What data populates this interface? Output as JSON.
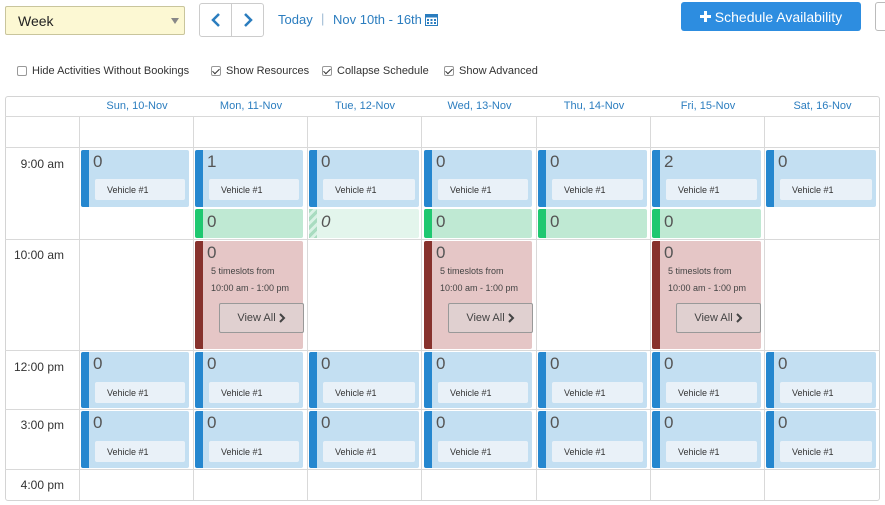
{
  "toolbar": {
    "view_select": "Week",
    "today": "Today",
    "range": "Nov 10th - 16th",
    "schedule_btn": "Schedule Availability"
  },
  "options": [
    {
      "label": "Hide Activities Without Bookings",
      "checked": false
    },
    {
      "label": "Show Resources",
      "checked": true
    },
    {
      "label": "Collapse Schedule",
      "checked": true
    },
    {
      "label": "Show Advanced",
      "checked": true
    }
  ],
  "days": [
    "Sun, 10-Nov",
    "Mon, 11-Nov",
    "Tue, 12-Nov",
    "Wed, 13-Nov",
    "Thu, 14-Nov",
    "Fri, 15-Nov",
    "Sat, 16-Nov"
  ],
  "times": [
    "9:00 am",
    "10:00 am",
    "12:00 pm",
    "3:00 pm",
    "4:00 pm"
  ],
  "resource_label": "Vehicle #1",
  "timeslot_line1": "5 timeslots from",
  "timeslot_line2": "10:00 am - 1:00 pm",
  "view_all": "View All",
  "row_9am_counts": [
    "0",
    "1",
    "0",
    "0",
    "0",
    "2",
    "0"
  ],
  "row_green_counts": [
    "0",
    "0",
    "0",
    "0",
    "0"
  ],
  "row_10am_counts": [
    "0",
    "0",
    "0"
  ],
  "row_12pm_counts": [
    "0",
    "0",
    "0",
    "0",
    "0",
    "0",
    "0"
  ],
  "row_3pm_counts": [
    "0",
    "0",
    "0",
    "0",
    "0",
    "0",
    "0"
  ],
  "colors": {
    "accent": "#2d8de0",
    "blue_bar": "#2587cf",
    "green_bar": "#1fc870",
    "red_bar": "#87322d"
  }
}
